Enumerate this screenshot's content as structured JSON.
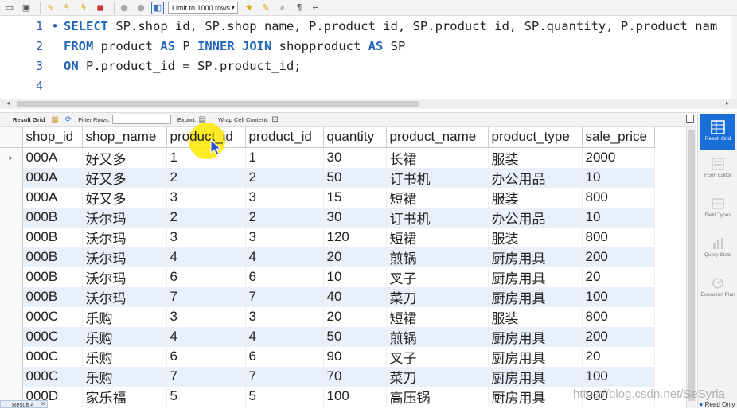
{
  "toolbar": {
    "limit_select": "Limit to 1000 rows"
  },
  "editor": {
    "lines": [
      {
        "num": "1",
        "bullet": "•"
      },
      {
        "num": "2",
        "bullet": ""
      },
      {
        "num": "3",
        "bullet": ""
      },
      {
        "num": "4",
        "bullet": ""
      }
    ],
    "line1": {
      "kw1": "SELECT",
      "rest": " SP.shop_id, SP.shop_name, P.product_id, SP.product_id, SP.quantity, P.product_nam"
    },
    "line2": {
      "kw1": "FROM",
      "t1": " product ",
      "kw2": "AS",
      "t2": " P ",
      "kw3": "INNER JOIN",
      "t3": " shopproduct ",
      "kw4": "AS",
      "t4": " SP"
    },
    "line3": {
      "kw1": "ON",
      "rest": " P.product_id = SP.product_id;"
    }
  },
  "result_bar": {
    "result_grid": "Result Grid",
    "filter_rows": "Filter Rows:",
    "export": "Export:",
    "wrap": "Wrap Cell Content:"
  },
  "grid": {
    "columns": [
      "shop_id",
      "shop_name",
      "product_id",
      "product_id",
      "quantity",
      "product_name",
      "product_type",
      "sale_price"
    ],
    "rows": [
      [
        "000A",
        "好又多",
        "1",
        "1",
        "30",
        "长裙",
        "服装",
        "2000"
      ],
      [
        "000A",
        "好又多",
        "2",
        "2",
        "50",
        "订书机",
        "办公用品",
        "10"
      ],
      [
        "000A",
        "好又多",
        "3",
        "3",
        "15",
        "短裙",
        "服装",
        "800"
      ],
      [
        "000B",
        "沃尔玛",
        "2",
        "2",
        "30",
        "订书机",
        "办公用品",
        "10"
      ],
      [
        "000B",
        "沃尔玛",
        "3",
        "3",
        "120",
        "短裙",
        "服装",
        "800"
      ],
      [
        "000B",
        "沃尔玛",
        "4",
        "4",
        "20",
        "煎锅",
        "厨房用具",
        "200"
      ],
      [
        "000B",
        "沃尔玛",
        "6",
        "6",
        "10",
        "叉子",
        "厨房用具",
        "20"
      ],
      [
        "000B",
        "沃尔玛",
        "7",
        "7",
        "40",
        "菜刀",
        "厨房用具",
        "100"
      ],
      [
        "000C",
        "乐购",
        "3",
        "3",
        "20",
        "短裙",
        "服装",
        "800"
      ],
      [
        "000C",
        "乐购",
        "4",
        "4",
        "50",
        "煎锅",
        "厨房用具",
        "200"
      ],
      [
        "000C",
        "乐购",
        "6",
        "6",
        "90",
        "叉子",
        "厨房用具",
        "20"
      ],
      [
        "000C",
        "乐购",
        "7",
        "7",
        "70",
        "菜刀",
        "厨房用具",
        "100"
      ],
      [
        "000D",
        "家乐福",
        "5",
        "5",
        "100",
        "高压锅",
        "厨房用具",
        "300"
      ]
    ]
  },
  "side_panel": {
    "result_grid": "Result Grid",
    "form_editor": "Form Editor",
    "field_types": "Field Types",
    "query_stats": "Query Stats",
    "execution_plan": "Execution Plan"
  },
  "status": {
    "result_tab": "Result 4",
    "read_only": "Read Only",
    "watermark": "https://blog.csdn.net/SeSyria"
  }
}
